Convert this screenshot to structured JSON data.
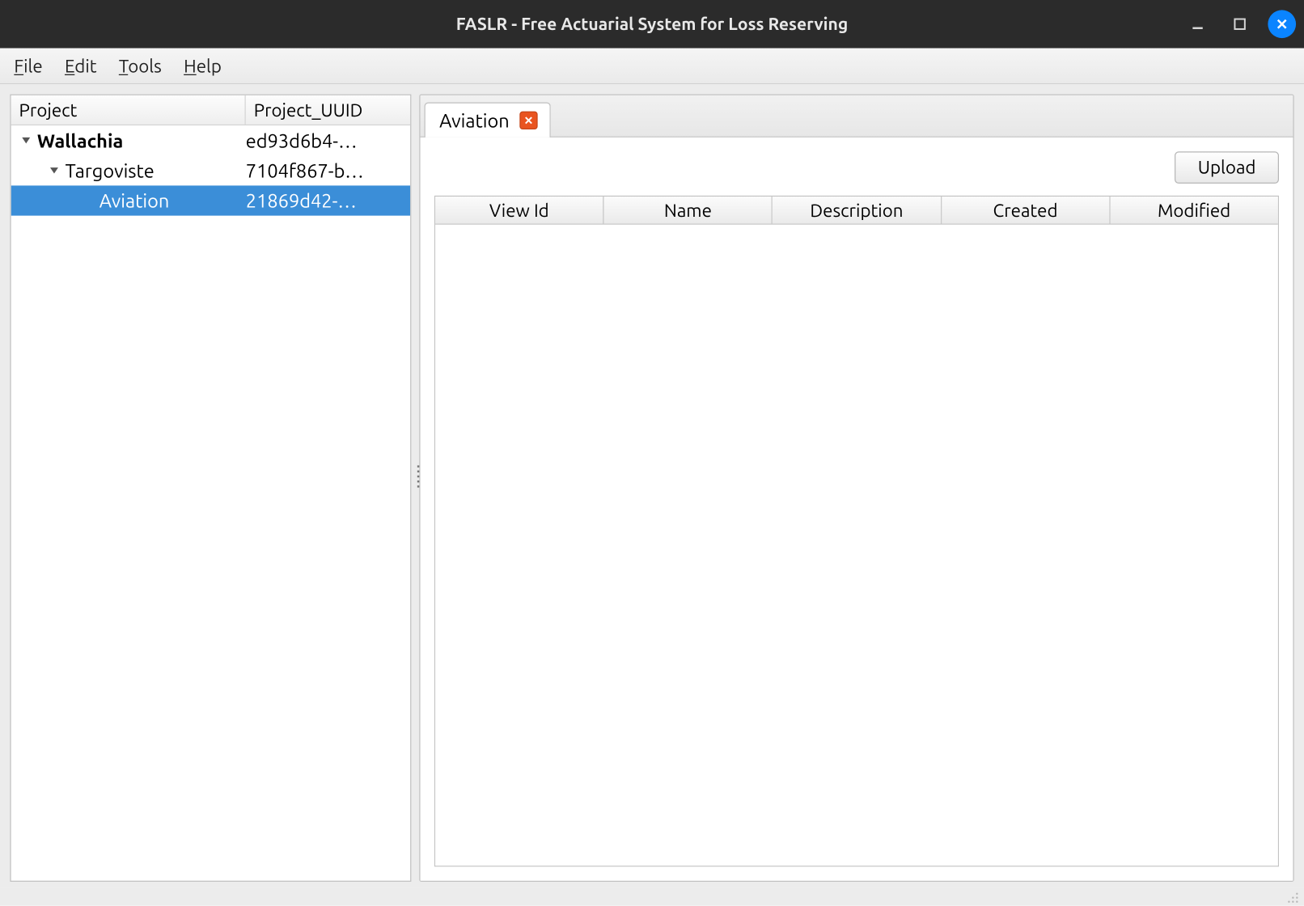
{
  "window": {
    "title": "FASLR - Free Actuarial System for Loss Reserving"
  },
  "menu": {
    "file": "File",
    "edit": "Edit",
    "tools": "Tools",
    "help": "Help"
  },
  "sidebar": {
    "headers": {
      "project": "Project",
      "uuid": "Project_UUID"
    },
    "rows": [
      {
        "label": "Wallachia",
        "uuid": "ed93d6b4-…"
      },
      {
        "label": "Targoviste",
        "uuid": "7104f867-b…"
      },
      {
        "label": "Aviation",
        "uuid": "21869d42-…"
      }
    ]
  },
  "tab": {
    "label": "Aviation"
  },
  "toolbar": {
    "upload": "Upload"
  },
  "table": {
    "columns": {
      "viewId": "View Id",
      "name": "Name",
      "description": "Description",
      "created": "Created",
      "modified": "Modified"
    }
  }
}
